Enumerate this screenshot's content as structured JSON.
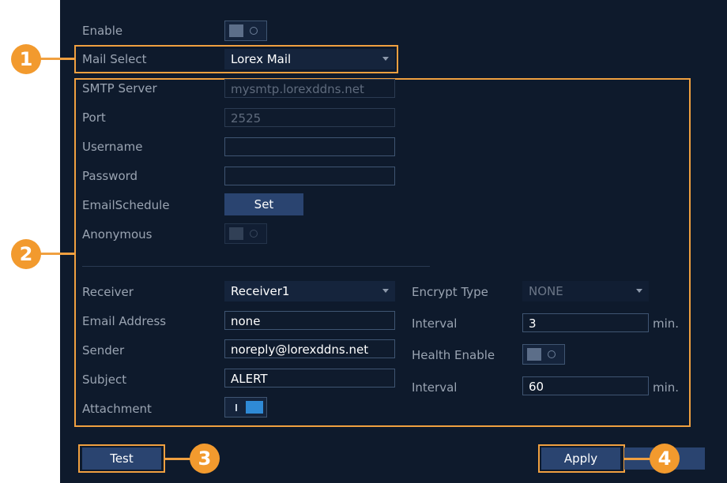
{
  "form": {
    "enable_label": "Enable",
    "mail_select": {
      "label": "Mail Select",
      "value": "Lorex Mail"
    },
    "smtp_server": {
      "label": "SMTP Server",
      "value": "mysmtp.lorexddns.net"
    },
    "port": {
      "label": "Port",
      "value": "2525"
    },
    "username": {
      "label": "Username",
      "value": ""
    },
    "password": {
      "label": "Password",
      "value": ""
    },
    "email_schedule": {
      "label": "EmailSchedule",
      "button": "Set"
    },
    "anonymous_label": "Anonymous",
    "receiver": {
      "label": "Receiver",
      "value": "Receiver1"
    },
    "email_address": {
      "label": "Email Address",
      "value": "none"
    },
    "sender": {
      "label": "Sender",
      "value": "noreply@lorexddns.net"
    },
    "subject": {
      "label": "Subject",
      "value": "ALERT"
    },
    "attachment_label": "Attachment",
    "encrypt_type": {
      "label": "Encrypt Type",
      "value": "NONE"
    },
    "interval1": {
      "label": "Interval",
      "value": "3",
      "unit": "min."
    },
    "health_enable_label": "Health Enable",
    "interval2": {
      "label": "Interval",
      "value": "60",
      "unit": "min."
    }
  },
  "toggles": {
    "enable": false,
    "anonymous": false,
    "health_enable": false,
    "attachment": true
  },
  "buttons": {
    "test": "Test",
    "apply": "Apply"
  },
  "callouts": [
    "1",
    "2",
    "3",
    "4"
  ],
  "colors": {
    "panel": "#0e1a2c",
    "callout": "#f29a2e",
    "toggle_on": "#2f8ad6",
    "button": "#2a4470"
  }
}
